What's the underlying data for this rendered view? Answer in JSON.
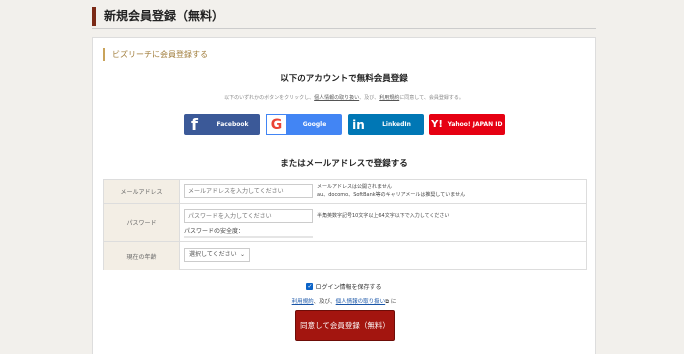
{
  "page": {
    "title": "新規会員登録（無料）"
  },
  "panel": {
    "heading": "ビズリーチに会員登録する"
  },
  "sns": {
    "title": "以下のアカウントで無料会員登録",
    "description_before": "以下のいずれかのボタンをクリックし、",
    "description_link1": "個人情報の取り扱い",
    "description_middle": "、及び、",
    "description_link2": "利用規約",
    "description_after": "に同意して、会員登録する。",
    "buttons": [
      {
        "label": "Facebook",
        "icon": "facebook-icon",
        "glyph": "f",
        "color": "#3b5998"
      },
      {
        "label": "Google",
        "icon": "google-icon",
        "glyph": "G",
        "color": "#4285f4"
      },
      {
        "label": "LinkedIn",
        "icon": "linkedin-icon",
        "glyph": "in",
        "color": "#0077b5"
      },
      {
        "label": "Yahoo! JAPAN ID",
        "icon": "yahoo-icon",
        "glyph": "Y!",
        "color": "#e60012"
      }
    ]
  },
  "mail": {
    "title": "またはメールアドレスで登録する",
    "fields": {
      "email": {
        "label": "メールアドレス",
        "placeholder": "メールアドレスを入力してください",
        "note1": "メールアドレスは公開されません",
        "note2": "au、docomo、SoftBank等のキャリアメールは推奨していません"
      },
      "password": {
        "label": "パスワード",
        "placeholder": "パスワードを入力してください",
        "note": "半角英数字記号10文字以上64文字以下で入力してください",
        "strength_label": "パスワードの安全度："
      },
      "age": {
        "label": "現在の年齢",
        "selected": "選択してください",
        "arrow": "⌄"
      }
    }
  },
  "save_login": {
    "label": "ログイン情報を保存する",
    "checked": true,
    "check_glyph": "✓"
  },
  "terms": {
    "link1": "利用規約",
    "sep": "、及び、",
    "link2": "個人情報の取り扱い",
    "icon": "external-link-icon",
    "icon_glyph": "⧉",
    "suffix": "に"
  },
  "submit": {
    "label": "同意して会員登録（無料）",
    "color": "#a3150f"
  }
}
